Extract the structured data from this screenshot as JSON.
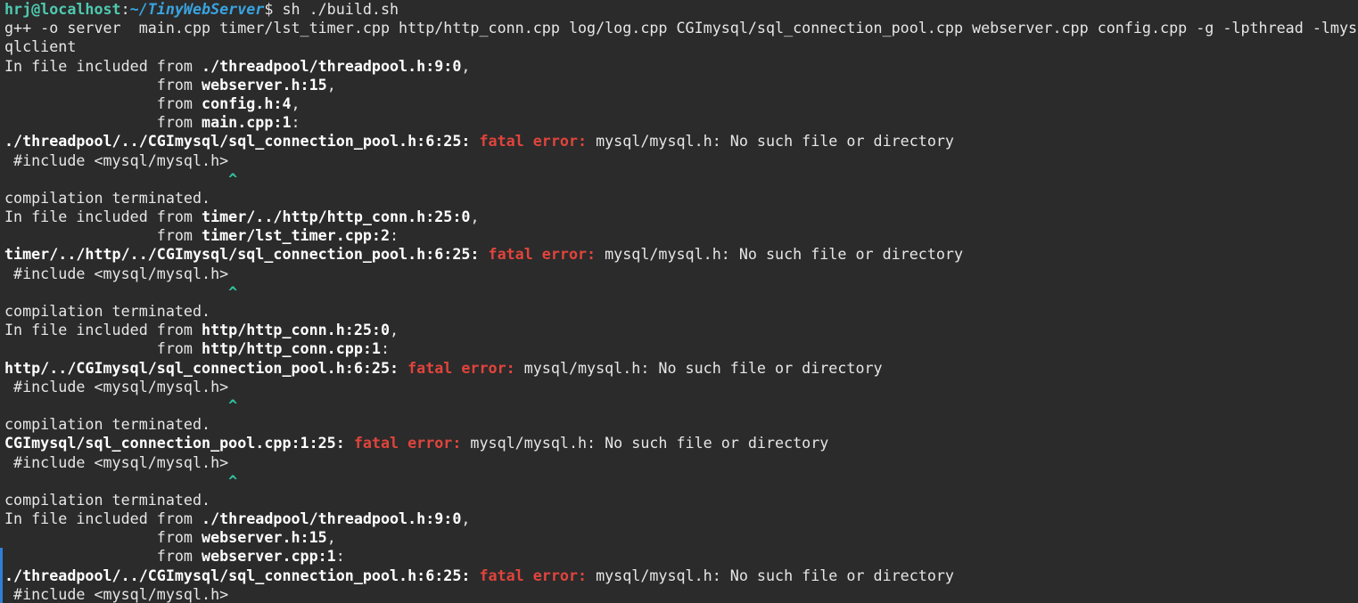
{
  "prompt": {
    "user_host": "hrj@localhost",
    "colon": ":",
    "path": "~/TinyWebServer",
    "symbol": "$",
    "command": " sh ./build.sh"
  },
  "build_cmd": {
    "line1": "g++ -o server  main.cpp timer/lst_timer.cpp http/http_conn.cpp log/log.cpp CGImysql/sql_connection_pool.cpp webserver.cpp config.cpp -g -lpthread -lmys",
    "line2": "qlclient"
  },
  "labels": {
    "in_file": "In file included from ",
    "from": "                 from ",
    "fatal": "fatal error:",
    "missing": " mysql/mysql.h: No such file or directory",
    "include": " #include <mysql/mysql.h>",
    "caret_pad": "                         ",
    "caret": "^",
    "terminated": "compilation terminated.",
    "comma": ",",
    "colon": ":",
    "space": " "
  },
  "blocks": {
    "b1": {
      "inc1": "./threadpool/threadpool.h:9:0",
      "from1": "webserver.h:15",
      "from2": "config.h:4",
      "from3": "main.cpp:1",
      "err_loc": "./threadpool/../CGImysql/sql_connection_pool.h:6:25:"
    },
    "b2": {
      "inc1": "timer/../http/http_conn.h:25:0",
      "from1": "timer/lst_timer.cpp:2",
      "err_loc": "timer/../http/../CGImysql/sql_connection_pool.h:6:25:"
    },
    "b3": {
      "inc1": "http/http_conn.h:25:0",
      "from1": "http/http_conn.cpp:1",
      "err_loc": "http/../CGImysql/sql_connection_pool.h:6:25:"
    },
    "b4": {
      "err_loc": "CGImysql/sql_connection_pool.cpp:1:25:"
    },
    "b5": {
      "inc1": "./threadpool/threadpool.h:9:0",
      "from1": "webserver.h:15",
      "from2": "webserver.cpp:1",
      "err_loc": "./threadpool/../CGImysql/sql_connection_pool.h:6:25:"
    }
  },
  "colors": {
    "background": "#2b2b2b",
    "text": "#e6e6e6",
    "prompt_user": "#4ec9b0",
    "prompt_path": "#3aa3e0",
    "error": "#e0443c",
    "caret": "#2fc6a0",
    "scroll_marker": "#2f7fd6"
  }
}
